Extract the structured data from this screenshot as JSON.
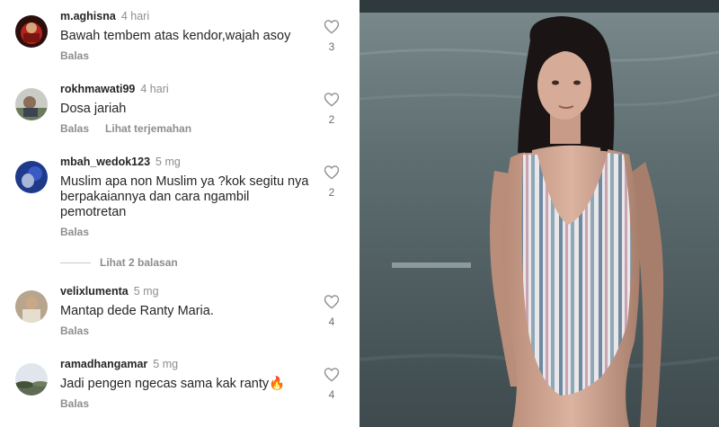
{
  "comments": [
    {
      "username": "m.aghisna",
      "time": "4 hari",
      "text": "Bawah tembem atas kendor,wajah asoy",
      "reply": "Balas",
      "translate": "",
      "likes": "3"
    },
    {
      "username": "rokhmawati99",
      "time": "4 hari",
      "text": "Dosa jariah",
      "reply": "Balas",
      "translate": "Lihat terjemahan",
      "likes": "2"
    },
    {
      "username": "mbah_wedok123",
      "time": "5 mg",
      "text": "Muslim apa non Muslim ya ?kok segitu nya berpakaiannya dan  cara ngambil pemotretan",
      "reply": "Balas",
      "translate": "",
      "likes": "2"
    },
    {
      "username": "velixlumenta",
      "time": "5 mg",
      "text": "Mantap dede Ranty Maria.",
      "reply": "Balas",
      "translate": "",
      "likes": "4"
    },
    {
      "username": "ramadhangamar",
      "time": "5 mg",
      "text": "Jadi pengen ngecas sama kak ranty🔥",
      "reply": "Balas",
      "translate": "",
      "likes": "4"
    }
  ],
  "view_replies": "Lihat 2 balasan",
  "icons": {
    "like": "heart-outline-icon"
  },
  "colors": {
    "username": "#262626",
    "secondary": "#8e8e8e",
    "background": "#ffffff"
  }
}
